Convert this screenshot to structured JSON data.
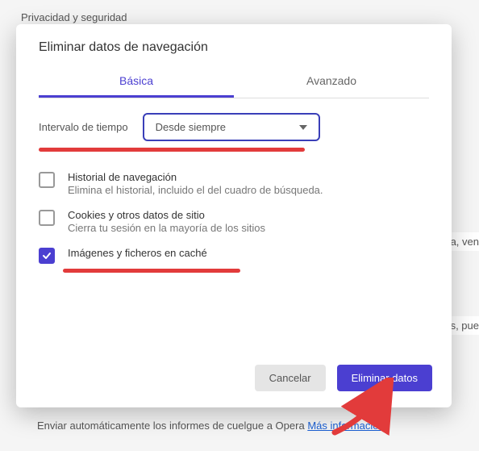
{
  "background": {
    "section_title": "Privacidad y seguridad",
    "right_frag1": "ra, ven",
    "right_frag2": "s, pue",
    "bottom_text": "Enviar automáticamente los informes de cuelgue a Opera",
    "bottom_link": "Más información"
  },
  "dialog": {
    "title": "Eliminar datos de navegación",
    "tabs": {
      "basic": "Básica",
      "advanced": "Avanzado"
    },
    "time_label": "Intervalo de tiempo",
    "time_value": "Desde siempre",
    "options": {
      "history": {
        "title": "Historial de navegación",
        "sub": "Elimina el historial, incluido el del cuadro de búsqueda."
      },
      "cookies": {
        "title": "Cookies y otros datos de sitio",
        "sub": "Cierra tu sesión en la mayoría de los sitios"
      },
      "cache": {
        "title": "Imágenes y ficheros en caché"
      }
    },
    "cancel": "Cancelar",
    "confirm": "Eliminar datos"
  }
}
